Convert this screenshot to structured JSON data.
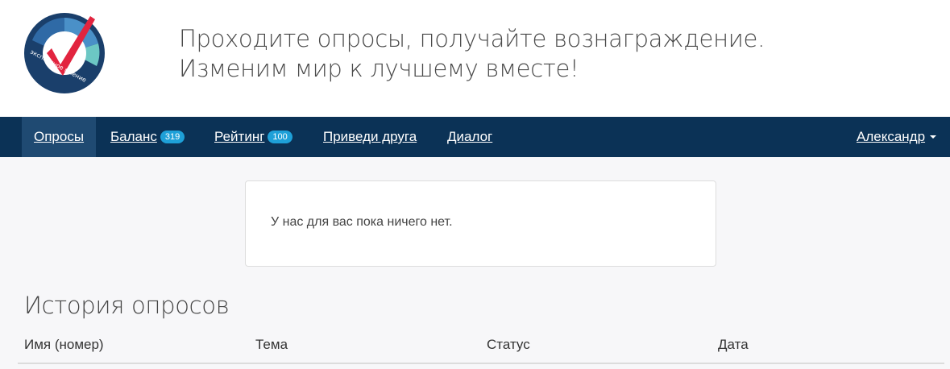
{
  "header": {
    "logo_text": "экспертное мнение",
    "slogan_line1": "Проходите опросы, получайте вознаграждение.",
    "slogan_line2": "Изменим мир к лучшему вместе!"
  },
  "nav": {
    "items": [
      {
        "label": "Опросы",
        "badge": null,
        "active": true
      },
      {
        "label": "Баланс",
        "badge": "319",
        "active": false
      },
      {
        "label": "Рейтинг",
        "badge": "100",
        "active": false
      },
      {
        "label": "Приведи друга",
        "badge": null,
        "active": false
      },
      {
        "label": "Диалог",
        "badge": null,
        "active": false
      }
    ],
    "user": "Александр",
    "user_icon": "caret-down-icon"
  },
  "notice": {
    "text": "У нас для вас пока ничего нет."
  },
  "history": {
    "title": "История опросов",
    "columns": [
      "Имя (номер)",
      "Тема",
      "Статус",
      "Дата"
    ]
  },
  "colors": {
    "navbar": "#0b3256",
    "nav_active": "#1f4a72",
    "badge": "#1ea0d8",
    "logo_check": "#e2243f"
  }
}
